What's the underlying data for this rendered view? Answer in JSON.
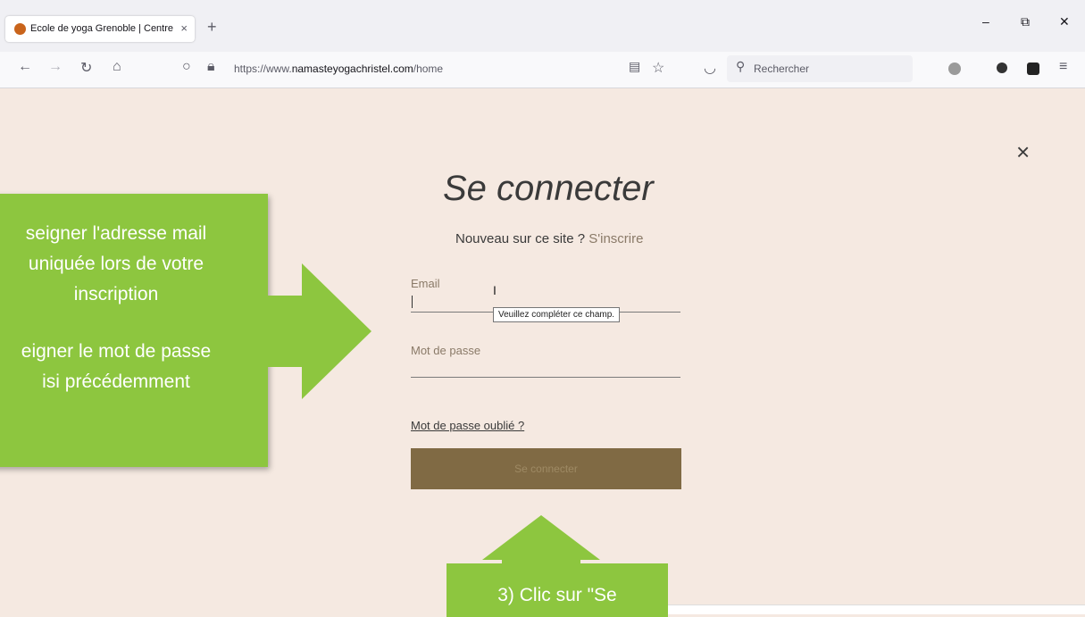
{
  "browser": {
    "tab_title": "Ecole de yoga Grenoble | Centre",
    "tab_close": "×",
    "new_tab": "+",
    "url_prefix": "https://www.",
    "url_domain": "namasteyogachristel.com",
    "url_path": "/home",
    "search_placeholder": "Rechercher",
    "window_min": "–",
    "window_restore": "⧉",
    "window_close": "✕"
  },
  "login": {
    "title": "Se connecter",
    "new_here": "Nouveau sur ce site ?",
    "signup_link": "S'inscrire",
    "email_label": "Email",
    "tooltip": "Veuillez compléter ce champ.",
    "password_label": "Mot de passe",
    "forgot_link": "Mot de passe oublié ?",
    "submit_label": "Se connecter",
    "close": "×"
  },
  "annotations": {
    "left_line1": "seigner l'adresse mail",
    "left_line2": "uniquée lors de votre",
    "left_line3": "inscription",
    "left_line4": "eigner le mot de passe",
    "left_line5": "isi précédemment",
    "bottom_text": "3) Clic sur \"Se"
  },
  "colors": {
    "page_bg": "#f5e9e1",
    "accent_green": "#8dc63f",
    "submit_bg": "#806a44"
  }
}
